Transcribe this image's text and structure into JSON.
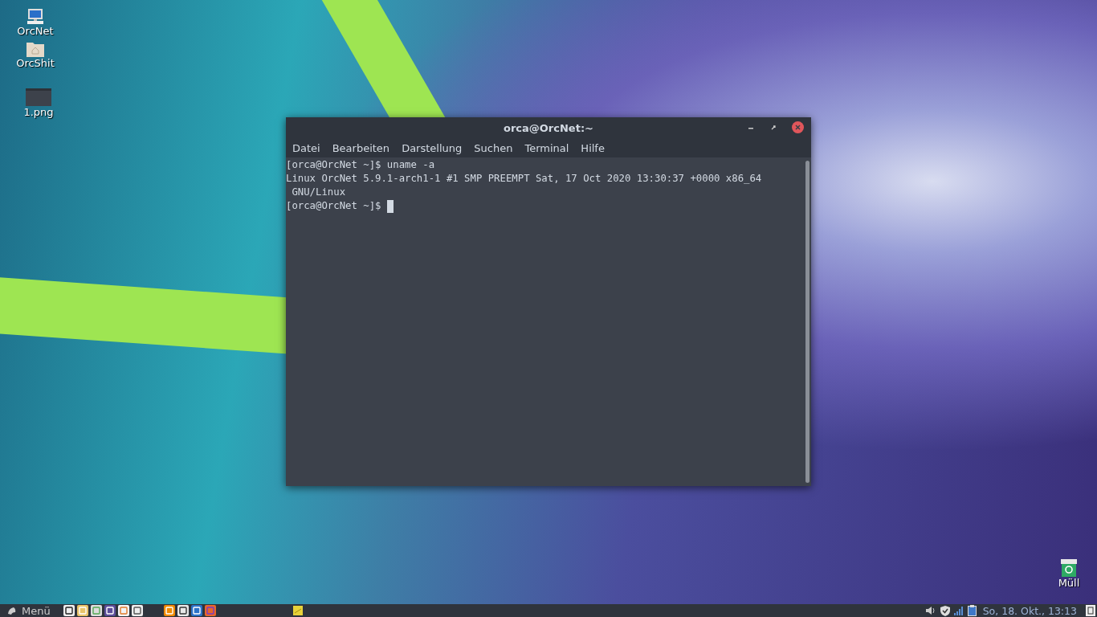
{
  "desktop_icons": [
    {
      "label": "OrcNet",
      "kind": "computer"
    },
    {
      "label": "OrcShit",
      "kind": "folder"
    },
    {
      "label": "1.png",
      "kind": "image"
    },
    {
      "label": "Müll",
      "kind": "trash"
    }
  ],
  "window": {
    "title": "orca@OrcNet:~",
    "menu": [
      "Datei",
      "Bearbeiten",
      "Darstellung",
      "Suchen",
      "Terminal",
      "Hilfe"
    ],
    "lines": [
      "[orca@OrcNet ~]$ uname -a",
      "Linux OrcNet 5.9.1-arch1-1 #1 SMP PREEMPT Sat, 17 Oct 2020 13:30:37 +0000 x86_64",
      " GNU/Linux",
      "[orca@OrcNet ~]$ "
    ],
    "cursor": true
  },
  "taskbar": {
    "menu_label": "Menü",
    "clock": "So, 18. Okt., 13:13"
  }
}
